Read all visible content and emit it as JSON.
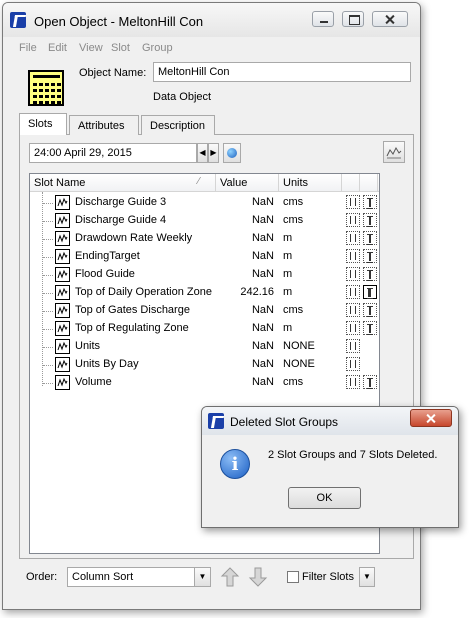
{
  "window": {
    "title": "Open Object - MeltonHill Con"
  },
  "menu": [
    "File",
    "Edit",
    "View",
    "Slot",
    "Group"
  ],
  "object": {
    "name_label": "Object Name:",
    "name_value": "MeltonHill Con",
    "type": "Data Object"
  },
  "tabs": [
    {
      "label": "Slots",
      "active": true
    },
    {
      "label": "Attributes",
      "active": false
    },
    {
      "label": "Description",
      "active": false
    }
  ],
  "timestep": "24:00 April 29, 2015",
  "table": {
    "headers": [
      "Slot Name",
      "Value",
      "Units"
    ],
    "rows": [
      {
        "name": "Discharge Guide 3",
        "value": "NaN",
        "units": "cms",
        "flags": 2
      },
      {
        "name": "Discharge Guide 4",
        "value": "NaN",
        "units": "cms",
        "flags": 2
      },
      {
        "name": "Drawdown Rate Weekly",
        "value": "NaN",
        "units": "m",
        "flags": 2
      },
      {
        "name": "EndingTarget",
        "value": "NaN",
        "units": "m",
        "flags": 2
      },
      {
        "name": "Flood Guide",
        "value": "NaN",
        "units": "m",
        "flags": 2
      },
      {
        "name": "Top of Daily Operation Zone",
        "value": "242.16",
        "units": "m",
        "flags": 2
      },
      {
        "name": "Top of Gates Discharge",
        "value": "NaN",
        "units": "cms",
        "flags": 2
      },
      {
        "name": "Top of Regulating Zone",
        "value": "NaN",
        "units": "m",
        "flags": 2
      },
      {
        "name": "Units",
        "value": "NaN",
        "units": "NONE",
        "flags": 1
      },
      {
        "name": "Units By Day",
        "value": "NaN",
        "units": "NONE",
        "flags": 1
      },
      {
        "name": "Volume",
        "value": "NaN",
        "units": "cms",
        "flags": 2
      }
    ]
  },
  "bottom": {
    "order_label": "Order:",
    "order_value": "Column Sort",
    "filter_label": "Filter Slots"
  },
  "dialog": {
    "title": "Deleted Slot Groups",
    "message": "2 Slot Groups and 7 Slots Deleted.",
    "ok": "OK"
  }
}
